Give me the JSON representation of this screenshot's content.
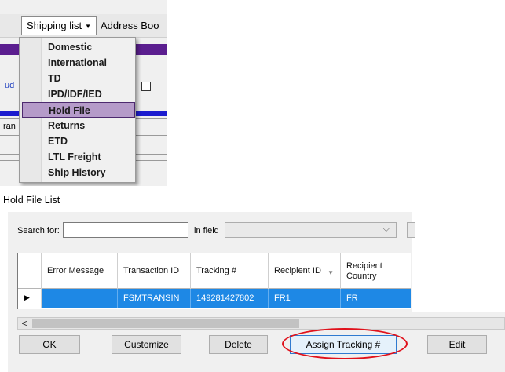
{
  "menu": {
    "shipping_list_label": "Shipping list",
    "address_book_label": "Address Boo",
    "items": [
      {
        "label": "Domestic"
      },
      {
        "label": "International"
      },
      {
        "label": "TD"
      },
      {
        "label": "IPD/IDF/IED"
      },
      {
        "label": "Hold File"
      },
      {
        "label": "Returns"
      },
      {
        "label": "ETD"
      },
      {
        "label": "LTL Freight"
      },
      {
        "label": "Ship History"
      }
    ],
    "selected_label": "Hold File",
    "background_link_fragment": "ud",
    "background_text_fragment": "ran"
  },
  "hold_file": {
    "title": "Hold File List",
    "search_label": "Search for:",
    "search_value": "",
    "in_field_label": "in field",
    "field_value": "",
    "columns": [
      "Error Message",
      "Transaction ID",
      "Tracking #",
      "Recipient ID",
      "Recipient Country"
    ],
    "rows": [
      {
        "error_message": "",
        "transaction_id": "FSMTRANSIN",
        "tracking": "149281427802",
        "recipient_id": "FR1",
        "recipient_country": "FR"
      }
    ]
  },
  "buttons": {
    "ok": "OK",
    "customize": "Customize",
    "delete": "Delete",
    "assign_tracking": "Assign Tracking #",
    "edit": "Edit"
  },
  "colors": {
    "selection_highlight": "#b59bc9",
    "grid_selection": "#1e88e5",
    "annotation_ellipse": "#e0111b",
    "purple_band": "#5b1e8f",
    "blue_band": "#1c1ccf"
  }
}
